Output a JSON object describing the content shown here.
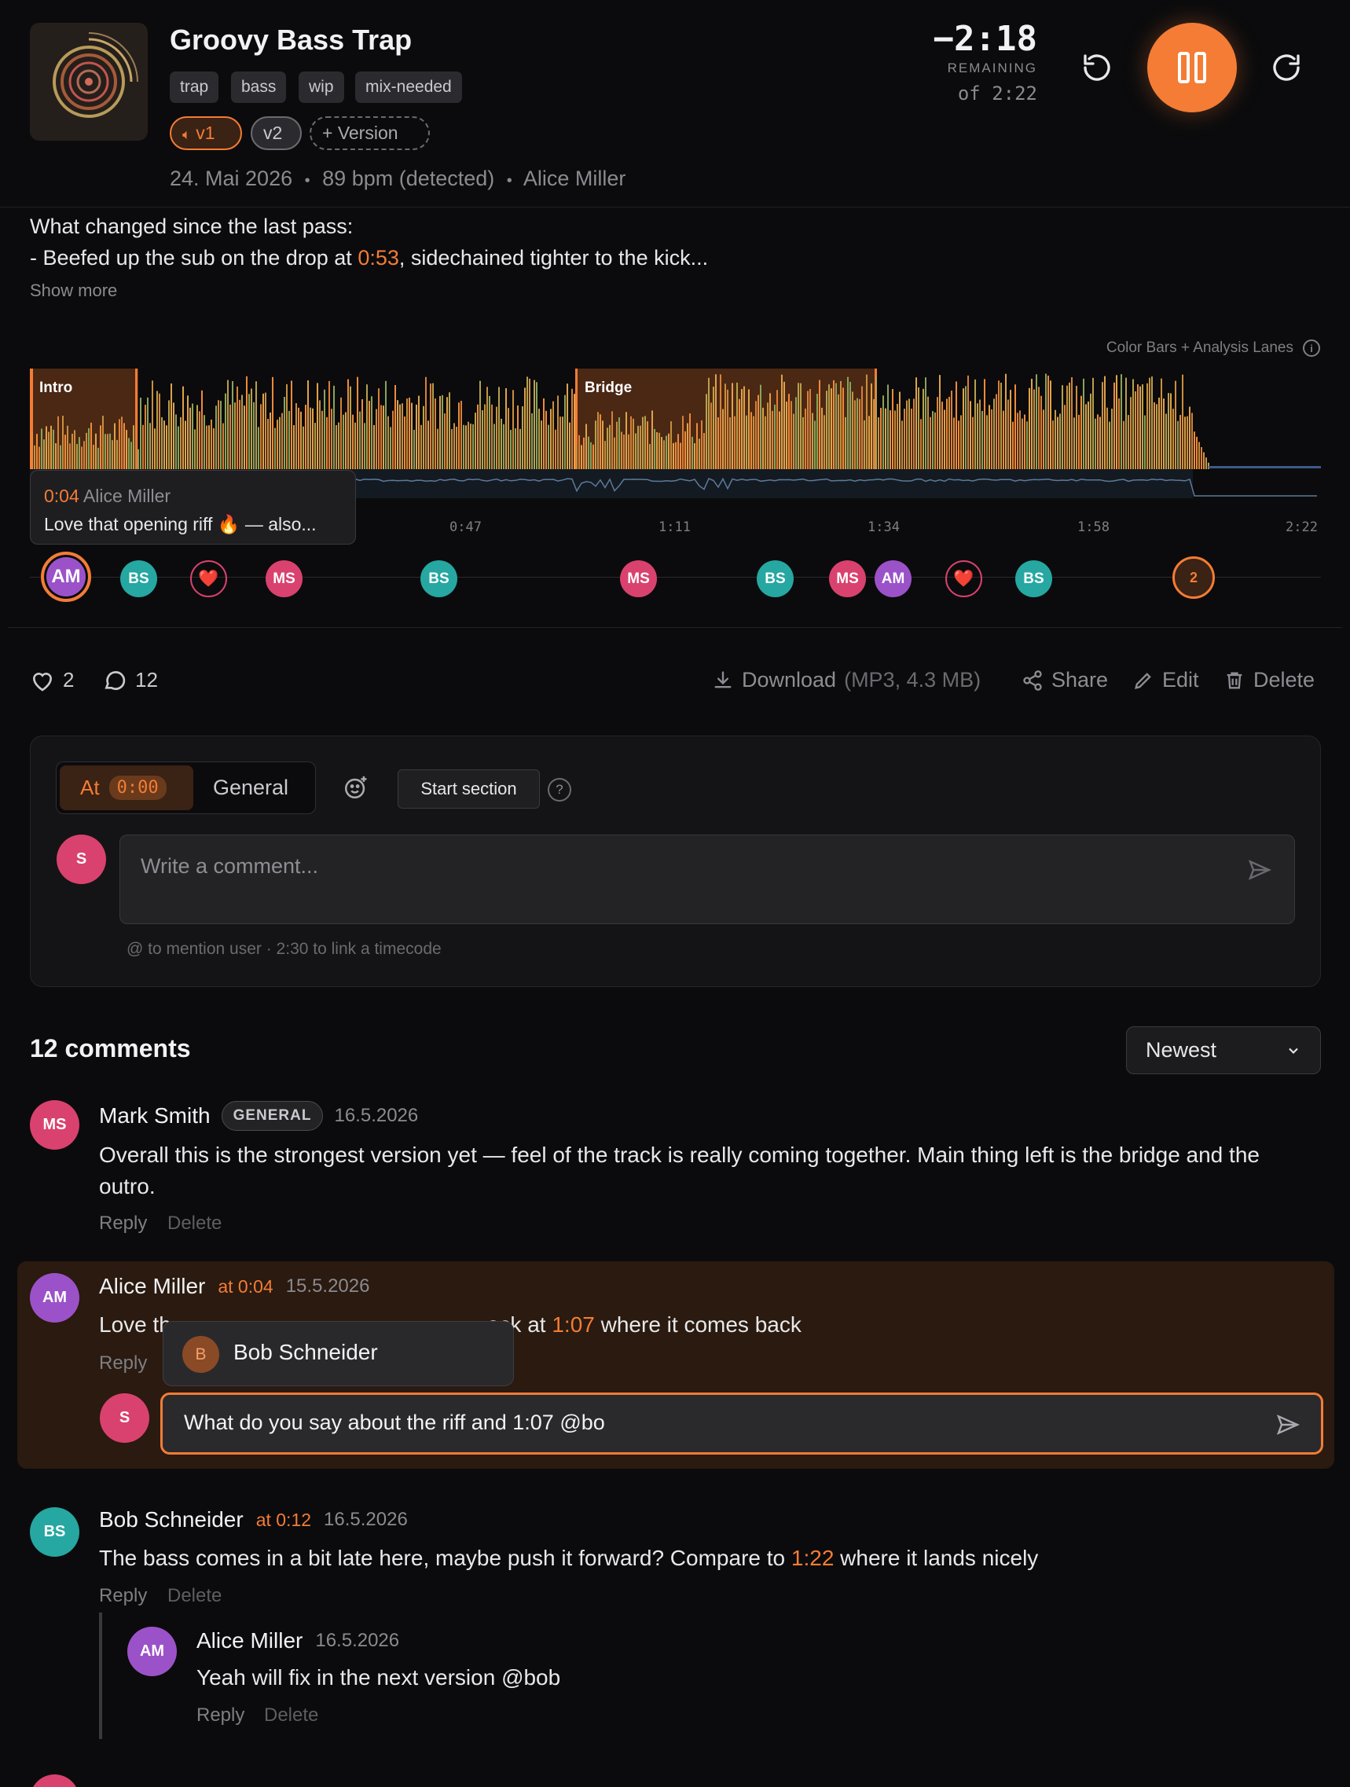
{
  "track": {
    "title": "Groovy Bass Trap",
    "tags": [
      "trap",
      "bass",
      "wip",
      "mix-needed"
    ],
    "versions": {
      "v1": "v1",
      "v2": "v2",
      "add": "+ Version"
    },
    "date": "24. Mai 2026",
    "bpm": "89 bpm (detected)",
    "author": "Alice Miller",
    "sep": "•"
  },
  "player": {
    "remaining_time": "−2:18",
    "remaining_label": "REMAINING",
    "total": "of 2:22",
    "accent": "#f47c35"
  },
  "description": {
    "line1": "What changed since the last pass:",
    "line2_pre": "- Beefed up the sub on the drop at ",
    "line2_time": "0:53",
    "line2_post": ", sidechained tighter to the kick...",
    "show_more": "Show more"
  },
  "waveform": {
    "view_mode": "Color Bars + Analysis Lanes",
    "sections": [
      {
        "label": "Intro"
      },
      {
        "label": "Bridge"
      }
    ],
    "ticks": [
      "0:47",
      "1:11",
      "1:34",
      "1:58",
      "2:22"
    ],
    "tooltip": {
      "time": "0:04",
      "author": "Alice Miller",
      "text": "Love that opening riff 🔥 — also..."
    },
    "markers": [
      {
        "label": "AM",
        "kind": "am"
      },
      {
        "label": "BS",
        "kind": "bs"
      },
      {
        "label": "❤️",
        "kind": "heart"
      },
      {
        "label": "MS",
        "kind": "ms"
      },
      {
        "label": "BS",
        "kind": "bs"
      },
      {
        "label": "MS",
        "kind": "ms"
      },
      {
        "label": "BS",
        "kind": "bs"
      },
      {
        "label": "MS",
        "kind": "ms"
      },
      {
        "label": "AM",
        "kind": "am"
      },
      {
        "label": "❤️",
        "kind": "heart"
      },
      {
        "label": "BS",
        "kind": "bs"
      },
      {
        "label": "2",
        "kind": "cluster"
      }
    ]
  },
  "stats": {
    "likes": "2",
    "comments": "12"
  },
  "actions": {
    "download": "Download",
    "download_meta": "(MP3, 4.3 MB)",
    "share": "Share",
    "edit": "Edit",
    "delete": "Delete"
  },
  "composer": {
    "at_label": "At",
    "at_time": "0:00",
    "general": "General",
    "start_section": "Start section",
    "help": "?",
    "avatar": "S",
    "placeholder": "Write a comment...",
    "hint": "@ to mention user · 2:30 to link a timecode"
  },
  "comments_header": {
    "title": "12 comments",
    "sort": "Newest"
  },
  "comments": [
    {
      "avatar": "MS",
      "name": "Mark Smith",
      "badge": "GENERAL",
      "date": "16.5.2026",
      "text_a": "Overall this is the strongest version yet — feel of the track is really coming together. Main thing left is the bridge and the",
      "text_b": "outro.",
      "reply": "Reply",
      "delete": "Delete"
    },
    {
      "avatar": "AM",
      "name": "Alice Miller",
      "at": "at 0:04",
      "date": "15.5.2026",
      "text_pre": "Love th",
      "text_mid": "ack at ",
      "text_time": "1:07",
      "text_post": " where it comes back",
      "reply": "Reply",
      "mention_popup": {
        "avatar": "B",
        "name": "Bob Schneider"
      },
      "reply_draft": {
        "avatar": "S",
        "value": "What do you say about the riff and 1:07 @bo"
      }
    },
    {
      "avatar": "BS",
      "name": "Bob Schneider",
      "at": "at 0:12",
      "date": "16.5.2026",
      "text_pre": "The bass comes in a bit late here, maybe push it forward? Compare to ",
      "text_time": "1:22",
      "text_post": " where it lands nicely",
      "reply": "Reply",
      "delete": "Delete",
      "replies": [
        {
          "avatar": "AM",
          "name": "Alice Miller",
          "date": "16.5.2026",
          "text": "Yeah will fix in the next version @bob",
          "reply": "Reply",
          "delete": "Delete"
        }
      ]
    }
  ]
}
